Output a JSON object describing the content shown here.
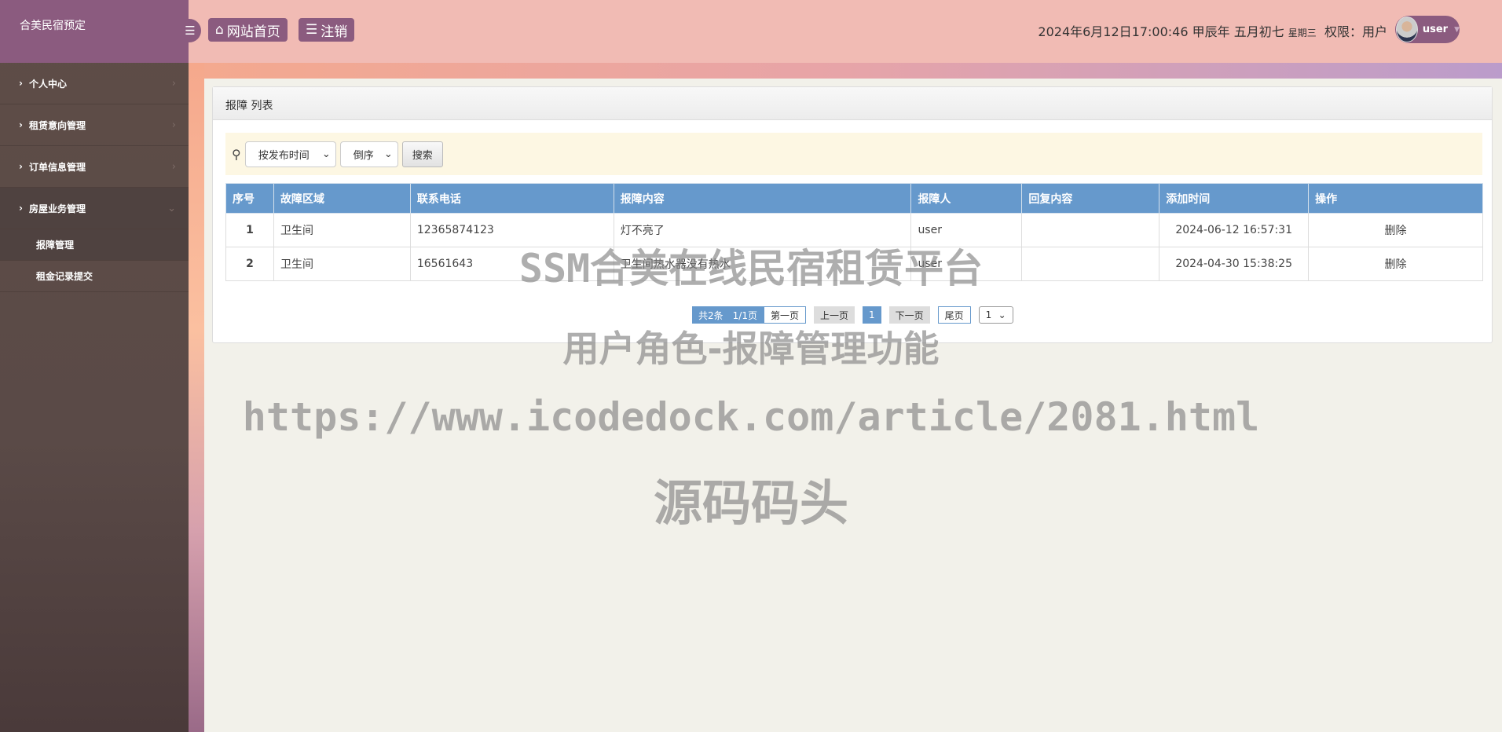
{
  "sidebar": {
    "brand": "合美民宿预定",
    "items": [
      {
        "label": "个人中心"
      },
      {
        "label": "租赁意向管理"
      },
      {
        "label": "订单信息管理"
      },
      {
        "label": "房屋业务管理",
        "expanded": true
      }
    ],
    "subitems": [
      {
        "label": "报障管理",
        "active": true
      },
      {
        "label": "租金记录提交"
      }
    ]
  },
  "header": {
    "home_label": "网站首页",
    "logout_label": "注销",
    "datetime": "2024年6月12日17:00:46 甲辰年 五月初七",
    "weekday": "星期三",
    "role": "权限：用户",
    "username": "user"
  },
  "panel": {
    "title": "报障 列表"
  },
  "search": {
    "sort_field": "按发布时间",
    "sort_order": "倒序",
    "search_label": "搜索"
  },
  "table": {
    "headers": [
      "序号",
      "故障区域",
      "联系电话",
      "报障内容",
      "报障人",
      "回复内容",
      "添加时间",
      "操作"
    ],
    "rows": [
      {
        "no": "1",
        "area": "卫生间",
        "phone": "12365874123",
        "content": "灯不亮了",
        "reporter": "user",
        "reply": "",
        "time": "2024-06-12 16:57:31",
        "action": "删除"
      },
      {
        "no": "2",
        "area": "卫生间",
        "phone": "16561643",
        "content": "卫生间热水器没有热水",
        "reporter": "user",
        "reply": "",
        "time": "2024-04-30 15:38:25",
        "action": "删除"
      }
    ]
  },
  "pagination": {
    "summary": "共2条　1/1页",
    "first": "第一页",
    "prev": "上一页",
    "current": "1",
    "next": "下一页",
    "last": "尾页",
    "page_select": "1"
  },
  "watermark": {
    "line1": "SSM合美在线民宿租赁平台",
    "line2": "用户角色-报障管理功能",
    "line3": "https://www.icodedock.com/article/2081.html",
    "line4": "源码码头"
  },
  "colors": {
    "brand": "#8b5b7f",
    "header": "#f1bbb4",
    "table_header": "#6699cc"
  }
}
